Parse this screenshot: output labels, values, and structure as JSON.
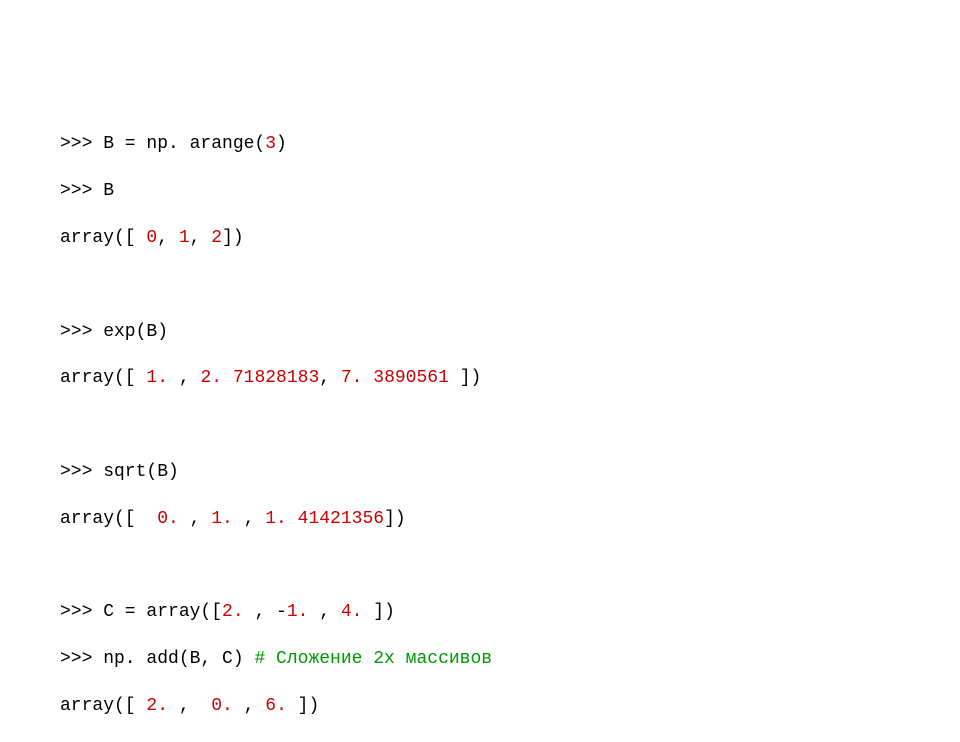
{
  "lines": {
    "l1_prompt": ">>>",
    "l1_a": " B = np. arange(",
    "l1_n1": "3",
    "l1_b": ")",
    "l2_prompt": ">>>",
    "l2_a": " B",
    "l3_a": "array([ ",
    "l3_n1": "0",
    "l3_b": ", ",
    "l3_n2": "1",
    "l3_c": ", ",
    "l3_n3": "2",
    "l3_d": "])",
    "l5_prompt": ">>>",
    "l5_a": " exp(B)",
    "l6_a": "array([ ",
    "l6_n1": "1.",
    "l6_b": " , ",
    "l6_n2": "2. 71828183",
    "l6_c": ", ",
    "l6_n3": "7. 3890561",
    "l6_d": " ])",
    "l8_prompt": ">>>",
    "l8_a": " sqrt(B)",
    "l9_a": "array([  ",
    "l9_n1": "0.",
    "l9_b": " , ",
    "l9_n2": "1.",
    "l9_c": " , ",
    "l9_n3": "1. 41421356",
    "l9_d": "])",
    "l11_prompt": ">>>",
    "l11_a": " C = array([",
    "l11_n1": "2.",
    "l11_b": " , -",
    "l11_n2": "1.",
    "l11_c": " , ",
    "l11_n3": "4.",
    "l11_d": " ])",
    "l12_prompt": ">>>",
    "l12_a": " np. add(B, C) ",
    "l12_comment": "# Сложение 2х массивов",
    "l13_a": "array([ ",
    "l13_n1": "2.",
    "l13_b": " ,  ",
    "l13_n2": "0.",
    "l13_c": " , ",
    "l13_n3": "6.",
    "l13_d": " ])"
  }
}
